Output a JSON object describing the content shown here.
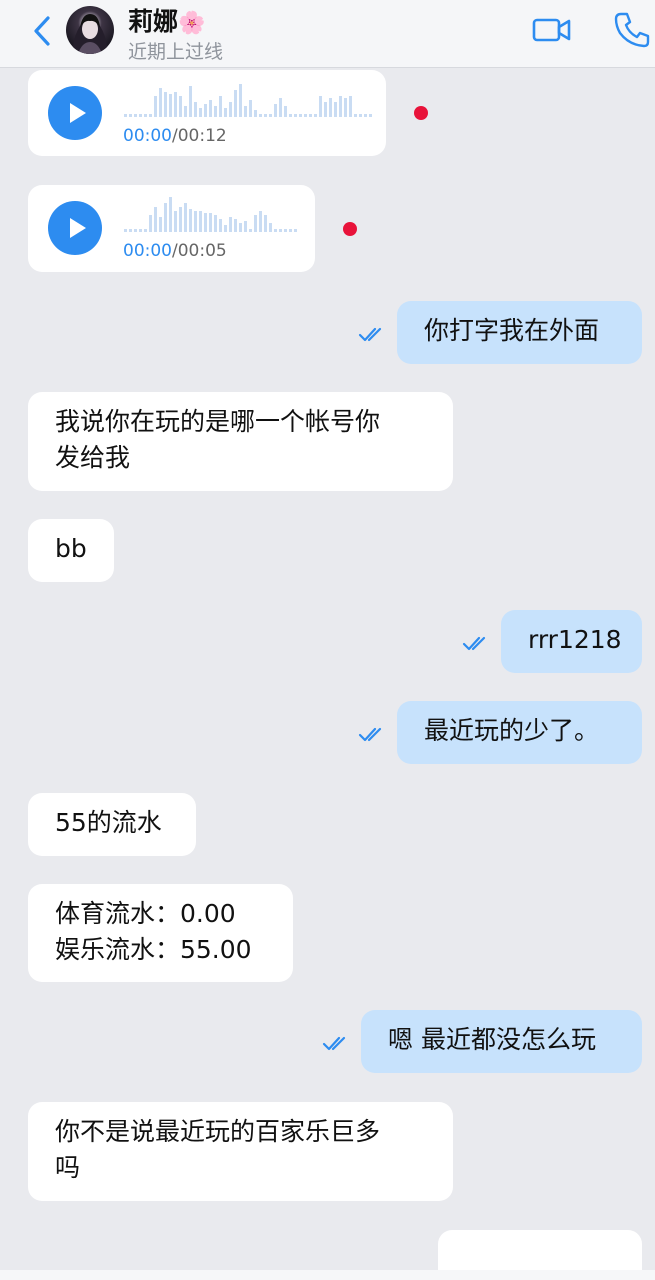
{
  "header": {
    "contact_name": "莉娜",
    "contact_emoji": "🌸",
    "status": "近期上过线",
    "icons": [
      "back-chevron-icon",
      "video-call-icon",
      "phone-call-icon"
    ]
  },
  "voice_messages": [
    {
      "current": "00:00",
      "total": "/00:12"
    },
    {
      "current": "00:00",
      "total": "/00:05"
    }
  ],
  "messages": [
    {
      "dir": "out",
      "text": "你打字我在外面"
    },
    {
      "dir": "in",
      "lines": [
        "我说你在玩的是哪一个帐号你",
        "发给我"
      ]
    },
    {
      "dir": "in",
      "text": "bb"
    },
    {
      "dir": "out",
      "text": "rrr1218"
    },
    {
      "dir": "out",
      "text": "最近玩的少了。"
    },
    {
      "dir": "in",
      "text": "55的流水"
    },
    {
      "dir": "in",
      "lines": [
        "体育流水：0.00",
        "娱乐流水：55.00"
      ]
    },
    {
      "dir": "out",
      "text": "嗯 最近都没怎么玩"
    },
    {
      "dir": "in",
      "lines": [
        "你不是说最近玩的百家乐巨多",
        "吗"
      ]
    }
  ],
  "colors": {
    "accent": "#2d8cf0",
    "outgoing_bubble": "#c7e2fc",
    "incoming_bubble": "#ffffff",
    "background": "#e9eaee",
    "unread_dot": "#e8133a"
  }
}
